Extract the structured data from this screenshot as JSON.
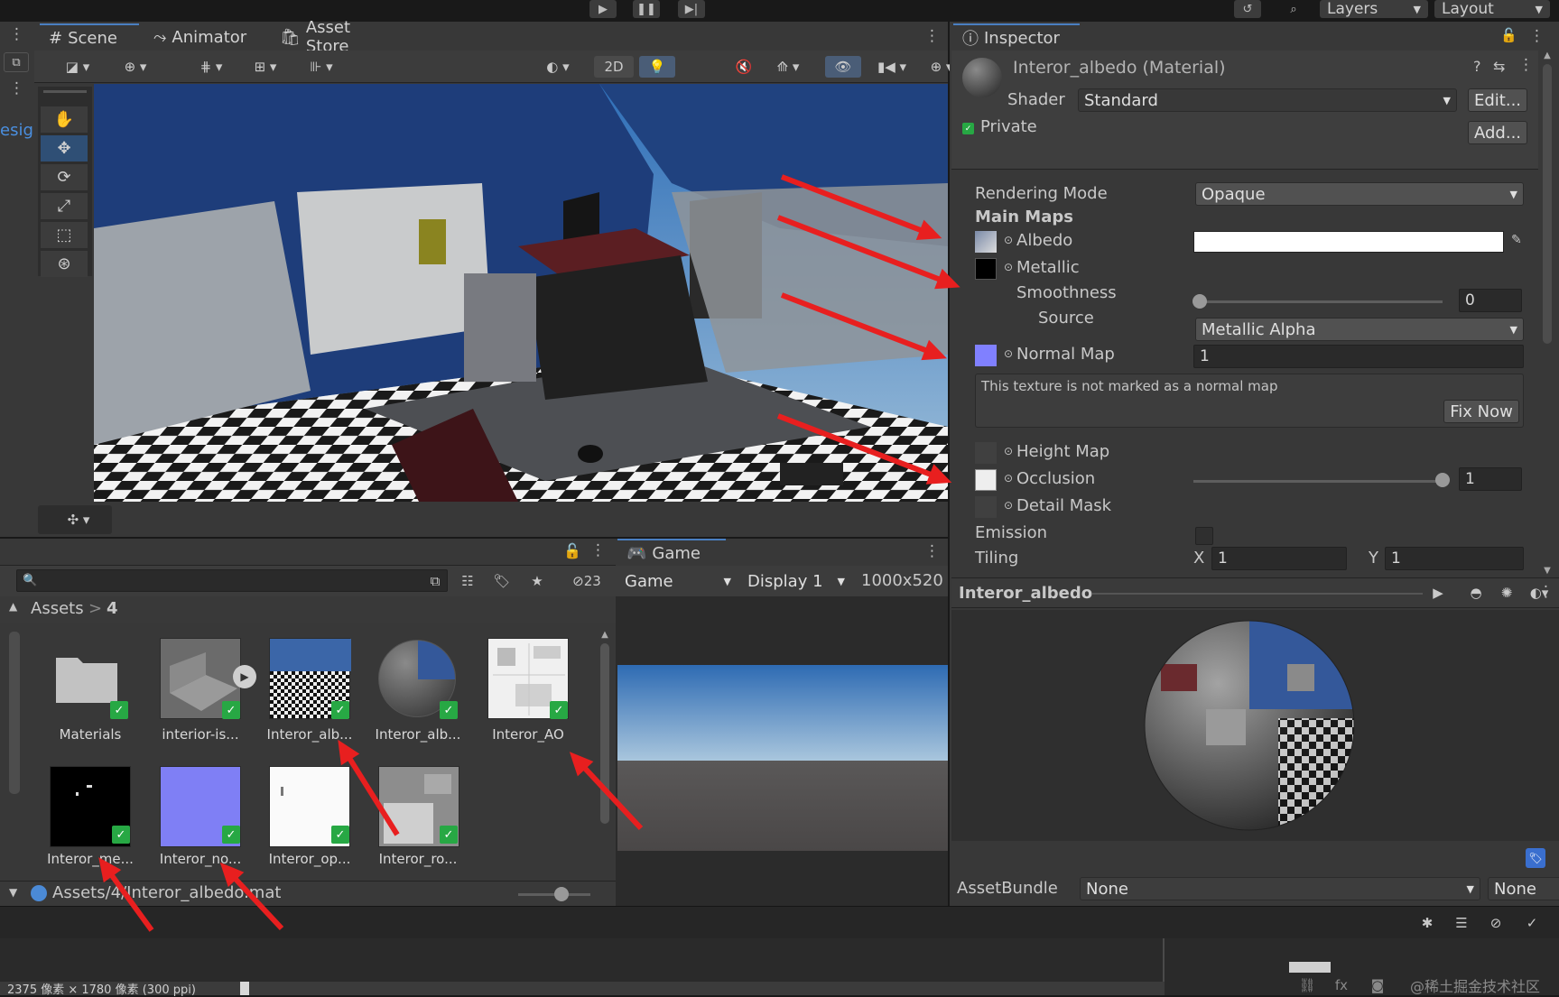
{
  "toolbar": {
    "play_icon": "play-icon",
    "pause_icon": "pause-icon",
    "step_icon": "step-icon",
    "layers_label": "Layers",
    "layout_label": "Layout"
  },
  "scene_tabs": [
    {
      "label": "Scene",
      "icon": "grid-icon"
    },
    {
      "label": "Animator",
      "icon": "animator-icon"
    },
    {
      "label": "Asset Store",
      "icon": "store-icon"
    }
  ],
  "scene_toolbar": {
    "mode_2d": "2D"
  },
  "left_sliver_text": "esig",
  "inspector": {
    "tab_label": "Inspector",
    "material_title": "Interor_albedo (Material)",
    "shader_label": "Shader",
    "shader_value": "Standard",
    "edit_button": "Edit...",
    "private_label": "Private",
    "add_button": "Add...",
    "rendering_mode_label": "Rendering Mode",
    "rendering_mode_value": "Opaque",
    "main_maps_label": "Main Maps",
    "albedo_label": "Albedo",
    "metallic_label": "Metallic",
    "smoothness_label": "Smoothness",
    "smoothness_value": "0",
    "source_label": "Source",
    "source_value": "Metallic Alpha",
    "normal_map_label": "Normal Map",
    "normal_map_value": "1",
    "normal_warning": "This texture is not marked as a normal map",
    "fix_now_button": "Fix Now",
    "height_map_label": "Height Map",
    "occlusion_label": "Occlusion",
    "occlusion_value": "1",
    "occlusion_level": 1,
    "detail_mask_label": "Detail Mask",
    "emission_label": "Emission",
    "tiling_label": "Tiling",
    "tiling_x_label": "X",
    "tiling_x": "1",
    "tiling_y_label": "Y",
    "tiling_y": "1",
    "preview_title": "Interor_albedo",
    "assetbundle_label": "AssetBundle",
    "assetbundle_value": "None",
    "assetbundle_variant": "None"
  },
  "project": {
    "hidden_count": "23",
    "breadcrumb_root": "Assets",
    "breadcrumb_sep": ">",
    "breadcrumb_folder": "4",
    "assets": [
      {
        "label": "Materials",
        "kind": "folder"
      },
      {
        "label": "interior-is...",
        "kind": "model"
      },
      {
        "label": "Interor_alb...",
        "kind": "texture-albedo"
      },
      {
        "label": "Interor_alb...",
        "kind": "material"
      },
      {
        "label": "Interor_AO",
        "kind": "texture-ao"
      },
      {
        "label": "Interor_me...",
        "kind": "texture-metallic"
      },
      {
        "label": "Interor_no...",
        "kind": "texture-normal"
      },
      {
        "label": "Interor_op...",
        "kind": "texture-opacity"
      },
      {
        "label": "Interor_ro...",
        "kind": "texture-roughness"
      }
    ],
    "selected_path": "Assets/4/Interor_albedo.mat"
  },
  "game": {
    "tab_label": "Game",
    "mode_value": "Game",
    "display_value": "Display 1",
    "resolution_value": "1000x520"
  },
  "status_bar_text": "2375 像素 × 1780 像素 (300 ppi)",
  "watermark": "@稀土掘金技术社区",
  "colors": {
    "accent": "#4a7fc1",
    "arrow": "#e81f1f",
    "check": "#27a844",
    "normal_swatch": "#8080ff"
  }
}
